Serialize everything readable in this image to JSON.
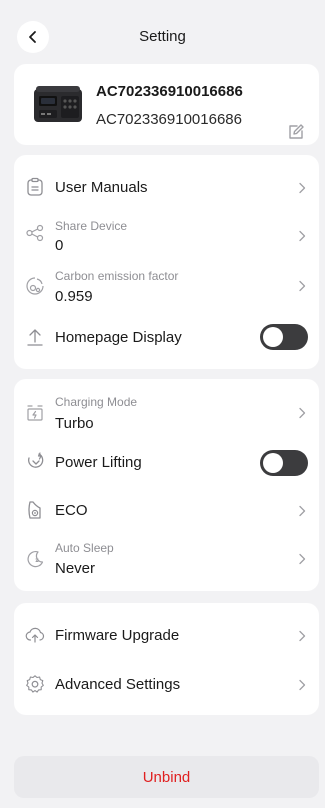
{
  "header": {
    "title": "Setting"
  },
  "device": {
    "name": "AC702336910016686",
    "serial": "AC702336910016686"
  },
  "settings_group_1": {
    "user_manuals": "User Manuals",
    "share_device": {
      "label": "Share Device",
      "value": "0"
    },
    "carbon_factor": {
      "label": "Carbon emission factor",
      "value": "0.959"
    },
    "homepage_display": {
      "label": "Homepage Display",
      "enabled": false
    }
  },
  "settings_group_2": {
    "charging_mode": {
      "label": "Charging Mode",
      "value": "Turbo"
    },
    "power_lifting": {
      "label": "Power Lifting",
      "enabled": false
    },
    "eco": "ECO",
    "auto_sleep": {
      "label": "Auto Sleep",
      "value": "Never"
    }
  },
  "settings_group_3": {
    "firmware_upgrade": "Firmware Upgrade",
    "advanced_settings": "Advanced Settings"
  },
  "footer": {
    "unbind_label": "Unbind"
  },
  "colors": {
    "background": "#f2f2f4",
    "card": "#ffffff",
    "toggle_off": "#3c3c3e",
    "danger": "#e02020",
    "secondary_text": "#8e8e93"
  },
  "icons": {
    "back": "chevron-left-icon",
    "edit": "edit-icon",
    "user_manuals": "clipboard-icon",
    "share_device": "share-icon",
    "carbon": "leaf-icon",
    "homepage_display": "upload-icon",
    "charging_mode": "battery-charging-icon",
    "power_lifting": "power-lifting-icon",
    "eco": "eco-icon",
    "auto_sleep": "moon-icon",
    "firmware_upgrade": "cloud-upload-icon",
    "advanced_settings": "gear-icon"
  }
}
